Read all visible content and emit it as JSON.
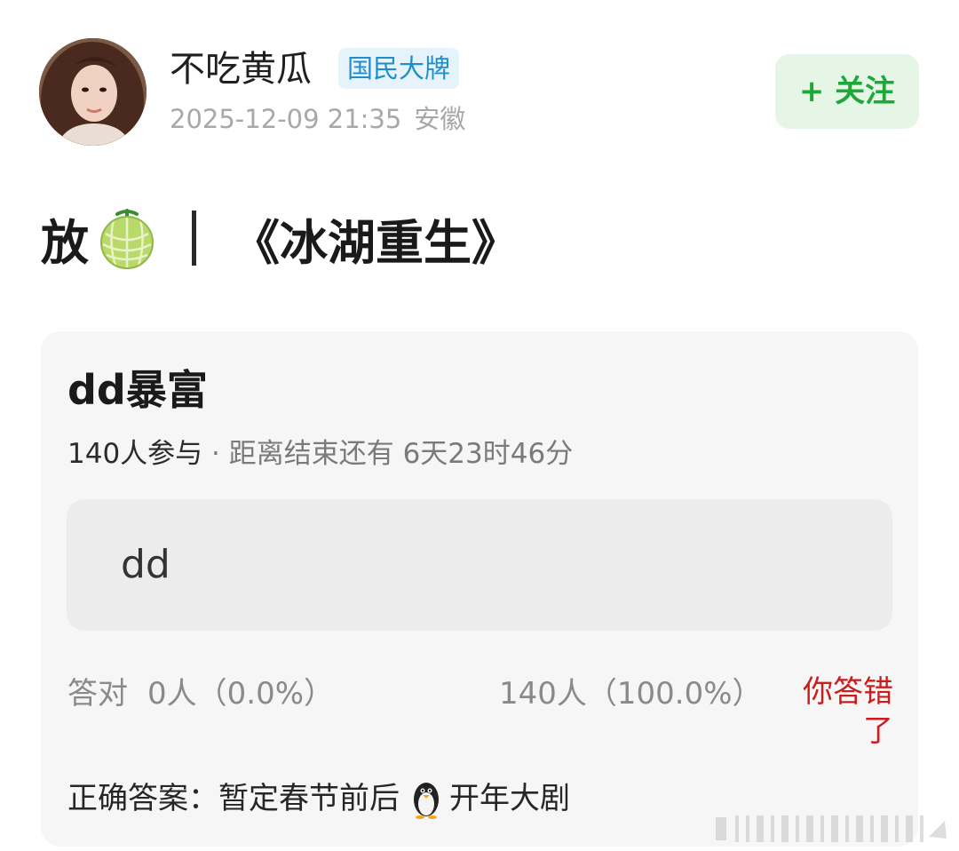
{
  "author": {
    "name": "不吃黄瓜",
    "badge": "国民大牌",
    "date": "2025-12-09 21:35",
    "location": "安徽"
  },
  "follow_button": {
    "label": "+ 关注"
  },
  "post": {
    "title_prefix": "放",
    "title_emoji": "melon-emoji",
    "title_main": "《冰湖重生》"
  },
  "quiz": {
    "title": "dd暴富",
    "participants": "140人参与",
    "deadline": " · 距离结束还有 6天23时46分",
    "option_text": "dd",
    "correct_label": "答对",
    "correct_value": "0人（0.0%）",
    "chosen_value": "140人（100.0%）",
    "result": "你答错了",
    "answer_label": "正确答案：",
    "answer_part1": "暂定春节前后",
    "answer_emoji": "penguin-emoji",
    "answer_part2": "开年大剧"
  },
  "colors": {
    "follow_green": "#1ea83a",
    "badge_blue": "#1d8fcf",
    "wrong_red": "#cc1d1d"
  }
}
